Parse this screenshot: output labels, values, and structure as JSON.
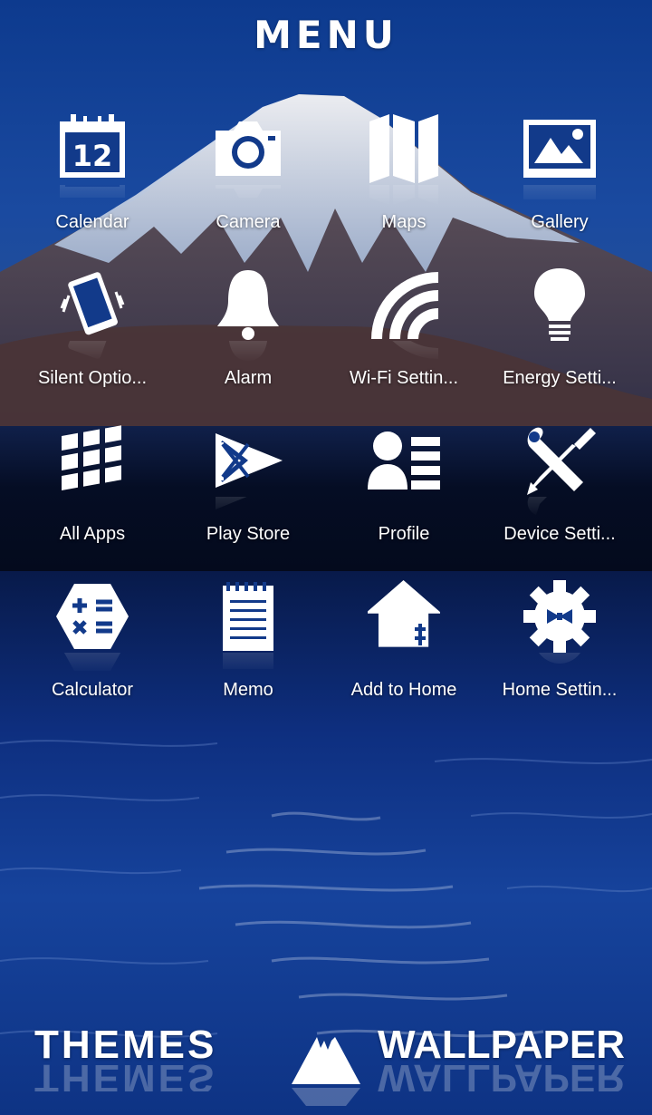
{
  "header": {
    "title": "MENU"
  },
  "apps": [
    {
      "label": "Calendar",
      "icon": "calendar-icon",
      "badge": "12"
    },
    {
      "label": "Camera",
      "icon": "camera-icon"
    },
    {
      "label": "Maps",
      "icon": "map-icon"
    },
    {
      "label": "Gallery",
      "icon": "gallery-icon"
    },
    {
      "label": "Silent Optio...",
      "icon": "vibrate-phone-icon"
    },
    {
      "label": "Alarm",
      "icon": "bell-icon"
    },
    {
      "label": "Wi-Fi Settin...",
      "icon": "wifi-icon"
    },
    {
      "label": "Energy Setti...",
      "icon": "lightbulb-icon"
    },
    {
      "label": "All Apps",
      "icon": "app-grid-icon"
    },
    {
      "label": "Play Store",
      "icon": "play-store-flag-icon"
    },
    {
      "label": "Profile",
      "icon": "profile-icon"
    },
    {
      "label": "Device Setti...",
      "icon": "wrench-screwdriver-icon"
    },
    {
      "label": "Calculator",
      "icon": "calculator-icon"
    },
    {
      "label": "Memo",
      "icon": "memo-icon"
    },
    {
      "label": "Add to Home",
      "icon": "add-to-home-icon"
    },
    {
      "label": "Home Settin...",
      "icon": "gear-icon"
    }
  ],
  "bottom": {
    "themes_label": "THEMES",
    "wallpaper_label": "WALLPAPER",
    "center_icon": "mount-fuji-icon"
  },
  "colors": {
    "background": "#0b2a6e",
    "icon": "#ffffff",
    "icon_detail": "#123a8a"
  }
}
